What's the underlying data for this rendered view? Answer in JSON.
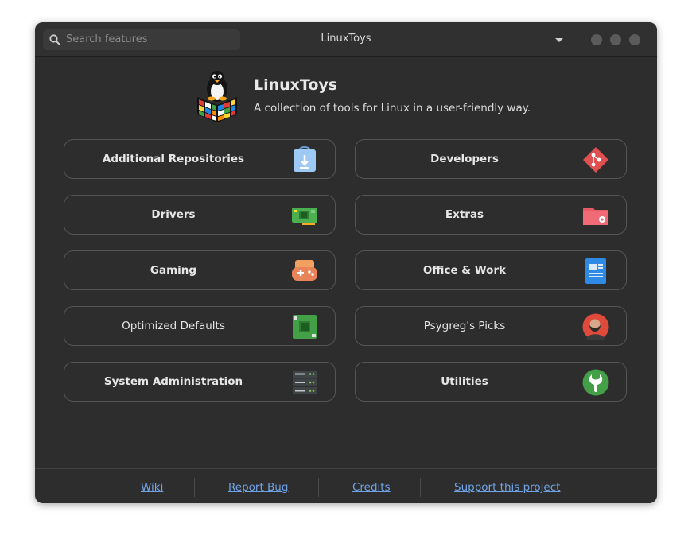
{
  "window": {
    "title": "LinuxToys",
    "search_placeholder": "Search features"
  },
  "header": {
    "app_name": "LinuxToys",
    "description": "A collection of tools for Linux in a user-friendly way.",
    "logo": "penguin-rubiks-cube-logo"
  },
  "categories": [
    {
      "label": "Additional Repositories",
      "icon": "package-bag-icon"
    },
    {
      "label": "Developers",
      "icon": "git-icon"
    },
    {
      "label": "Drivers",
      "icon": "circuit-board-icon"
    },
    {
      "label": "Extras",
      "icon": "folder-gear-icon"
    },
    {
      "label": "Gaming",
      "icon": "gamepad-icon"
    },
    {
      "label": "Office & Work",
      "icon": "document-icon"
    },
    {
      "label": "Optimized Defaults",
      "icon": "chip-board-icon"
    },
    {
      "label": "Psygreg's Picks",
      "icon": "avatar-icon"
    },
    {
      "label": "System Administration",
      "icon": "server-rack-icon"
    },
    {
      "label": "Utilities",
      "icon": "wrench-icon"
    }
  ],
  "footer": {
    "links": [
      "Wiki",
      "Report Bug",
      "Credits",
      "Support this project"
    ]
  },
  "colors": {
    "window_bg": "#2d2d2d",
    "card_border": "#555555",
    "link": "#6fa3e6"
  }
}
